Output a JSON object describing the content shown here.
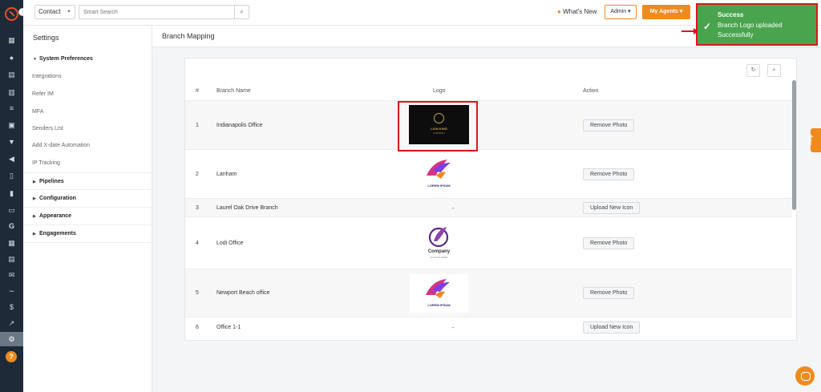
{
  "topbar": {
    "contact_select": "Contact",
    "search_placeholder": "Smart Search",
    "whats_new": "What's New",
    "admin": "Admin",
    "agents": "My Agents"
  },
  "settings": {
    "title": "Settings",
    "system_preferences": "System Preferences",
    "items": [
      "Integrations",
      "Refer IM",
      "MFA",
      "Senders List",
      "Add X-date Automation",
      "IP Tracking"
    ],
    "sections": [
      "Pipelines",
      "Configuration",
      "Appearance",
      "Engagements"
    ]
  },
  "page": {
    "title": "Branch Mapping"
  },
  "table": {
    "headers": [
      "#",
      "Branch Name",
      "Logo",
      "Action"
    ],
    "rows": [
      {
        "num": "1",
        "name": "Indianapolis Office",
        "logo": "LION KING",
        "logo_sub": "COMPANY",
        "action": "Remove Photo"
      },
      {
        "num": "2",
        "name": "Lanham",
        "logo": "LOREM IPSUM",
        "logo_sub": "",
        "action": "Remove Photo"
      },
      {
        "num": "3",
        "name": "Laurel Oak Drive Branch",
        "logo": "-",
        "logo_sub": "",
        "action": "Upload New Icon"
      },
      {
        "num": "4",
        "name": "Lodi Office",
        "logo": "Company",
        "logo_sub": "SLOGAN HERE",
        "action": "Remove Photo"
      },
      {
        "num": "5",
        "name": "Newport Beach office",
        "logo": "LOREM IPSUM",
        "logo_sub": "",
        "action": "Remove Photo"
      },
      {
        "num": "6",
        "name": "Office 1-1",
        "logo": "-",
        "logo_sub": "",
        "action": "Upload New Icon"
      }
    ]
  },
  "toast": {
    "title": "Success",
    "message": "Branch Logo uploaded Successfully"
  },
  "help_tab": "Help",
  "colors": {
    "accent": "#f08a1c",
    "success": "#4aa44e",
    "highlight": "#e0141c",
    "rail": "#1e2a38"
  }
}
